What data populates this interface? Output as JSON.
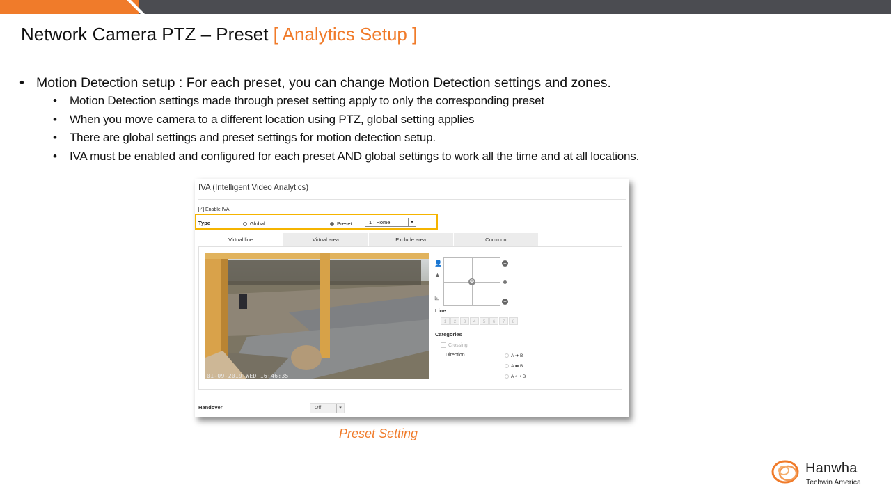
{
  "slide": {
    "title_main": "Network Camera PTZ – Preset ",
    "title_accent": "[ Analytics Setup ]",
    "bullet_main": "Motion Detection setup : For each preset, you can change Motion Detection settings and zones.",
    "sub_bullets": [
      "Motion Detection settings made through preset setting apply to only the corresponding preset",
      "When you move camera to a different location using PTZ, global setting applies",
      "There are global settings and preset settings for motion detection setup.",
      "IVA must be enabled and configured for each preset AND global settings to work all the time and at all locations."
    ],
    "caption": "Preset Setting",
    "colors": {
      "accent": "#f07b2a",
      "topbar": "#4b4c51",
      "highlight": "#f5b400"
    }
  },
  "iva": {
    "title": "IVA (Intelligent Video Analytics)",
    "enable_label": "Enable IVA",
    "type_label": "Type",
    "global_label": "Global",
    "preset_label": "Preset",
    "preset_value": "1 : Home",
    "tabs": [
      "Virtual line",
      "Virtual area",
      "Exclude area",
      "Common"
    ],
    "timestamp": "01-09-2019 WED 16:46:35",
    "line_label": "Line",
    "line_numbers": [
      "1",
      "2",
      "3",
      "4",
      "5",
      "6",
      "7",
      "8"
    ],
    "categories_label": "Categories",
    "crossing_label": "Crossing",
    "direction_label": "Direction",
    "directions": [
      "A ➜ B",
      "A ⬅ B",
      "A ⟷ B"
    ],
    "handover_label": "Handover",
    "handover_value": "Off"
  },
  "logo": {
    "name": "Hanwha",
    "sub": "Techwin America"
  }
}
